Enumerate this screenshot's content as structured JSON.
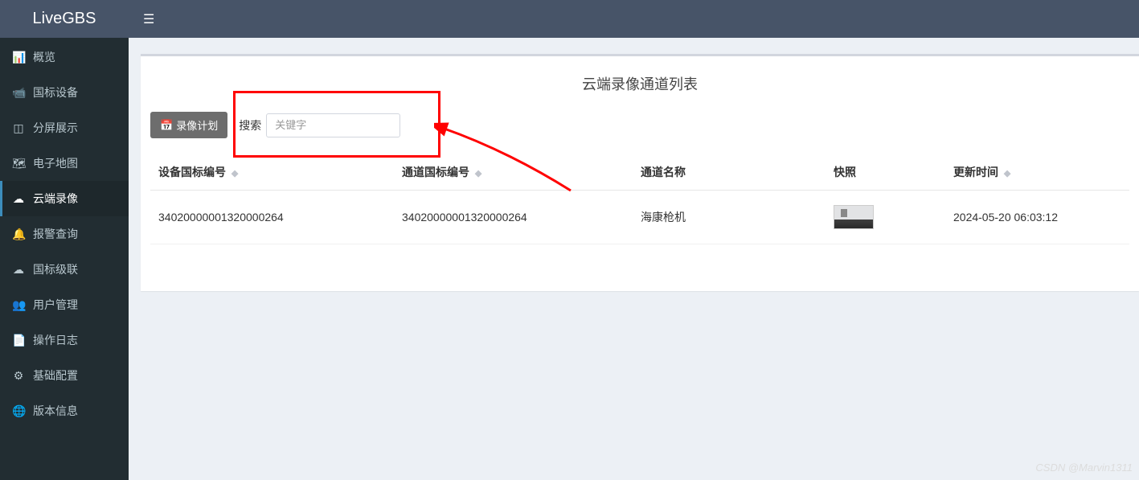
{
  "app": {
    "title": "LiveGBS"
  },
  "sidebar": {
    "items": [
      {
        "label": "概览",
        "icon": "📊"
      },
      {
        "label": "国标设备",
        "icon": "📹"
      },
      {
        "label": "分屏展示",
        "icon": "◫"
      },
      {
        "label": "电子地图",
        "icon": "🗺"
      },
      {
        "label": "云端录像",
        "icon": "☁"
      },
      {
        "label": "报警查询",
        "icon": "🔔"
      },
      {
        "label": "国标级联",
        "icon": "☁"
      },
      {
        "label": "用户管理",
        "icon": "👥"
      },
      {
        "label": "操作日志",
        "icon": "📄"
      },
      {
        "label": "基础配置",
        "icon": "⚙"
      },
      {
        "label": "版本信息",
        "icon": "🌐"
      }
    ],
    "activeIndex": 4
  },
  "page": {
    "title": "云端录像通道列表",
    "toolbar": {
      "recordPlanLabel": "录像计划",
      "searchLabel": "搜索",
      "searchPlaceholder": "关键字"
    },
    "table": {
      "columns": [
        {
          "label": "设备国标编号",
          "sortable": true
        },
        {
          "label": "通道国标编号",
          "sortable": true
        },
        {
          "label": "通道名称",
          "sortable": false
        },
        {
          "label": "快照",
          "sortable": false
        },
        {
          "label": "更新时间",
          "sortable": true
        }
      ],
      "rows": [
        {
          "deviceId": "34020000001320000264",
          "channelId": "34020000001320000264",
          "channelName": "海康枪机",
          "updatedAt": "2024-05-20 06:03:12"
        }
      ]
    }
  },
  "watermark": "CSDN @Marvin1311"
}
